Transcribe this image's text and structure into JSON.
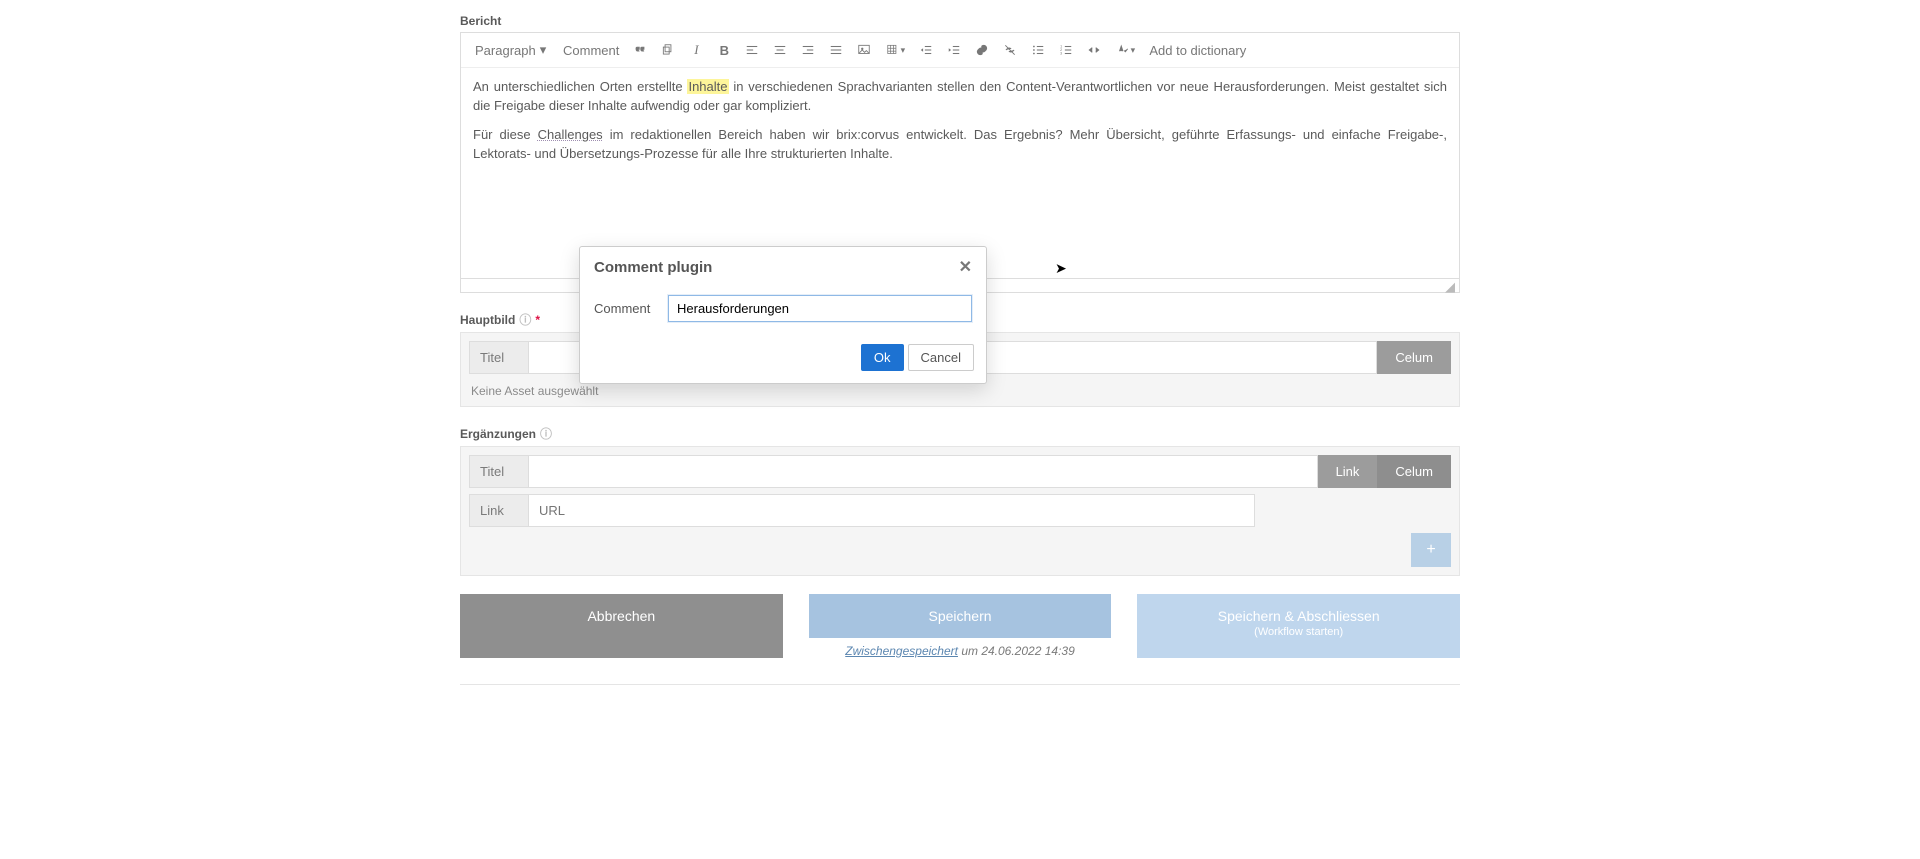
{
  "sections": {
    "bericht_label": "Bericht",
    "hauptbild_label": "Hauptbild",
    "ergaenzungen_label": "Ergänzungen"
  },
  "toolbar": {
    "paragraph": "Paragraph",
    "comment": "Comment",
    "add_dict": "Add to dictionary"
  },
  "editor": {
    "p1_a": "An unterschiedlichen Orten erstellte ",
    "p1_hl": "Inhalte",
    "p1_b": " in verschiedenen Sprachvarianten stellen den Content-Verantwortlichen vor neue Herausforderungen. Meist gestaltet sich die Freigabe dieser Inhalte aufwendig oder gar kompliziert.",
    "p2_a": "Für diese ",
    "p2_sq": "Challenges",
    "p2_b": " im redaktionellen Bereich haben wir brix:corvus entwickelt. Das Ergebnis? Mehr Übersicht, geführte Erfassungs- und einfache Freigabe-, Lektorats- und Übersetzungs-Prozesse für alle Ihre strukturierten Inhalte."
  },
  "hauptbild": {
    "titel_label": "Titel",
    "celum": "Celum",
    "none": "Keine Asset ausgewählt"
  },
  "erg": {
    "titel_label": "Titel",
    "link_label": "Link",
    "url_placeholder": "URL",
    "link_btn": "Link",
    "celum": "Celum",
    "add": "+"
  },
  "actions": {
    "cancel": "Abbrechen",
    "save": "Speichern",
    "close": "Speichern & Abschliessen",
    "close_sub": "(Workflow starten)",
    "autosave_link": "Zwischengespeichert",
    "autosave_rest": " um 24.06.2022 14:39"
  },
  "modal": {
    "title": "Comment plugin",
    "label": "Comment",
    "value": "Herausforderungen",
    "ok": "Ok",
    "cancel": "Cancel"
  }
}
